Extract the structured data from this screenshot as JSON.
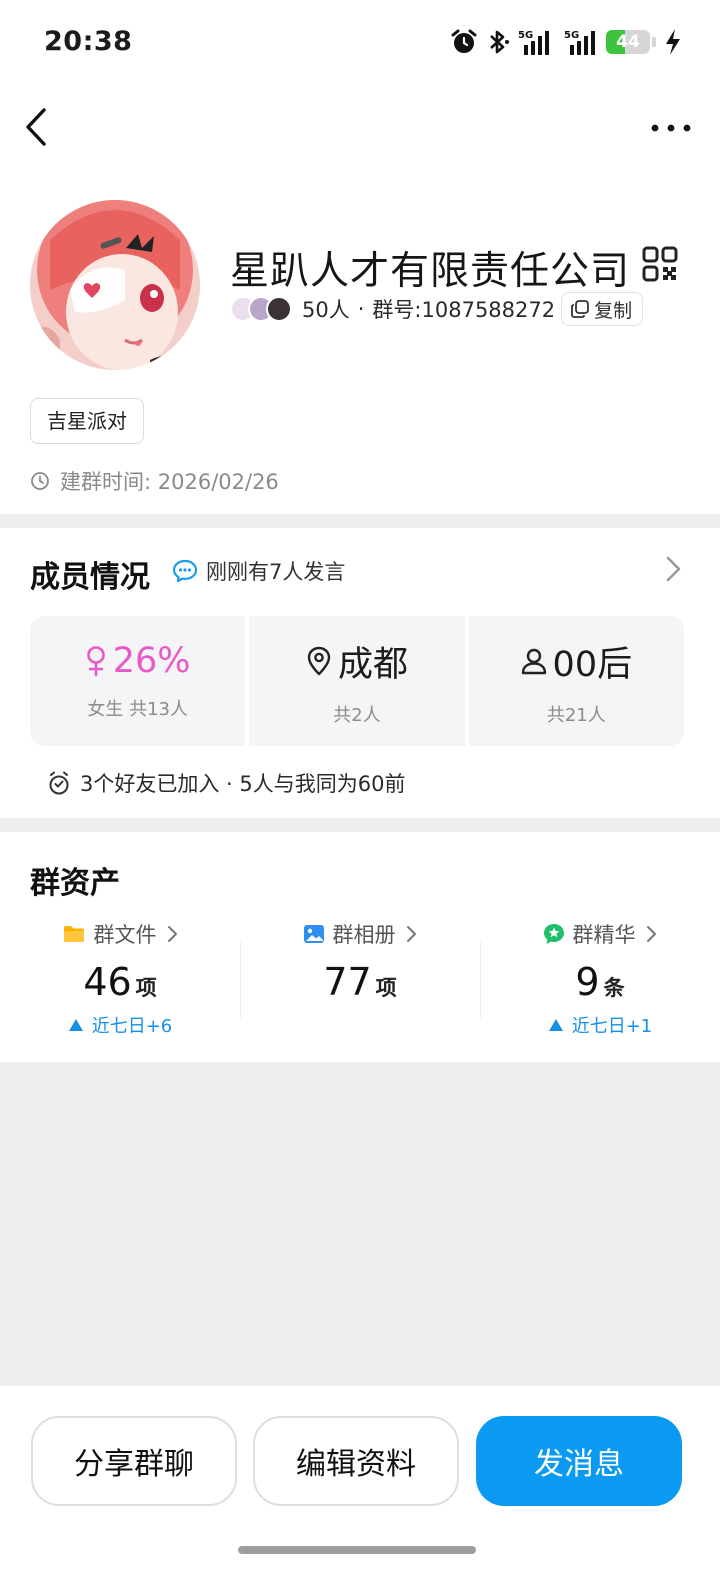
{
  "status_bar": {
    "time": "20:38",
    "battery_level": "44",
    "battery_fraction": 0.44,
    "network_1": "5G",
    "network_2": "5G"
  },
  "nav": {
    "back_icon": "chevron-left-icon",
    "more_icon": "more-dots-icon"
  },
  "profile": {
    "group_name": "星趴人才有限责任公司",
    "member_count": "50人",
    "separator": "·",
    "group_id_label": "群号:1087588272",
    "copy_label": "复制",
    "tag": "吉星派对",
    "created_label": "建群时间: 2026/02/26"
  },
  "members": {
    "title": "成员情况",
    "recent_activity": "刚刚有7人发言",
    "stats": [
      {
        "main": "26%",
        "sub": "女生 共13人",
        "icon": "female-icon"
      },
      {
        "main": "成都",
        "sub": "共2人",
        "icon": "location-pin-icon"
      },
      {
        "main": "00后",
        "sub": "共21人",
        "icon": "person-icon"
      }
    ],
    "friends_note": "3个好友已加入 · 5人与我同为60前"
  },
  "assets": {
    "title": "群资产",
    "items": [
      {
        "label": "群文件",
        "count": "46",
        "unit": "项",
        "trend": "近七日+6",
        "icon": "folder-icon"
      },
      {
        "label": "群相册",
        "count": "77",
        "unit": "项",
        "trend": "",
        "icon": "image-icon"
      },
      {
        "label": "群精华",
        "count": "9",
        "unit": "条",
        "trend": "近七日+1",
        "icon": "star-badge-icon"
      }
    ]
  },
  "actions": {
    "share": "分享群聊",
    "edit": "编辑资料",
    "message": "发消息"
  },
  "colors": {
    "primary": "#0a9af2",
    "female_pink": "#e958c8",
    "trend_blue": "#1890e8",
    "folder_yellow": "#f7b500",
    "album_blue": "#2f8ff0",
    "essence_green": "#1fc06a",
    "battery_green": "#3cc43f"
  }
}
